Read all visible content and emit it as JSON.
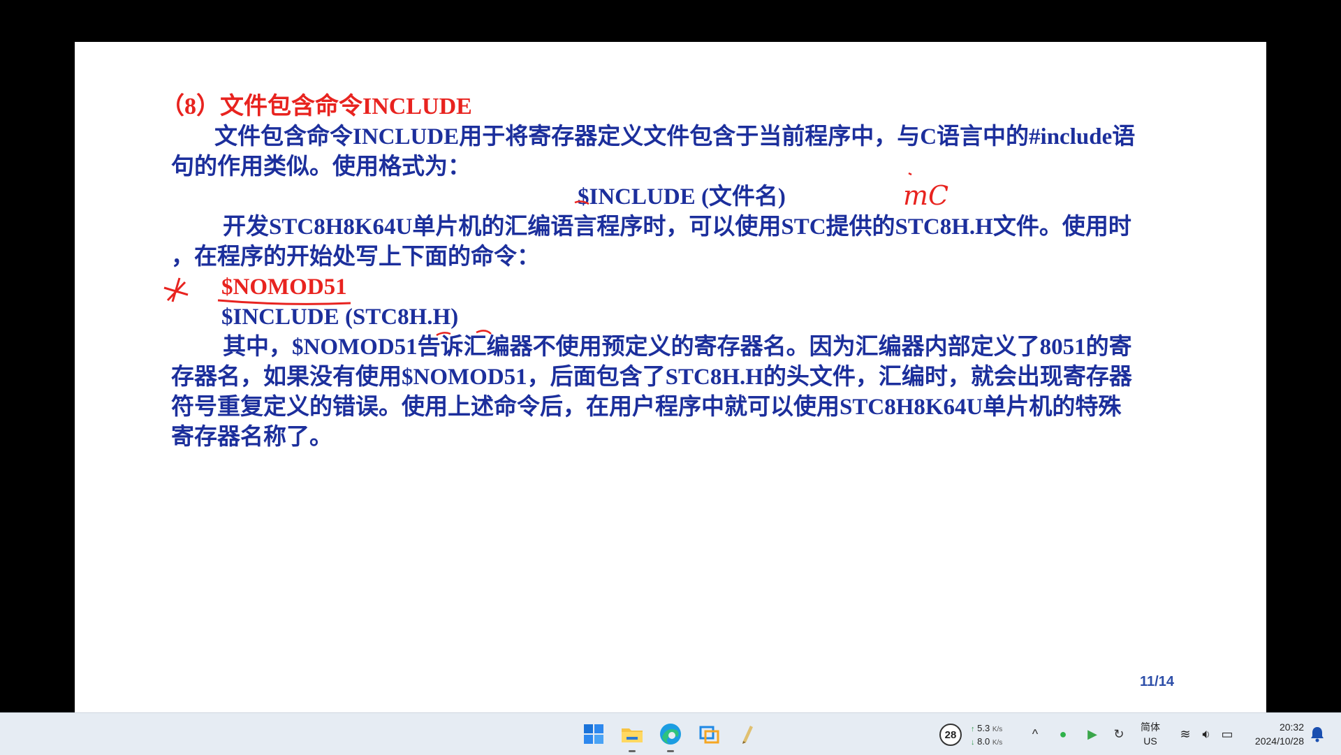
{
  "slide": {
    "heading": "（8）文件包含命令INCLUDE",
    "lines": [
      "文件包含命令INCLUDE用于将寄存器定义文件包含于当前程序中，与C语言中的#include语",
      "句的作用类似。使用格式为：",
      "$INCLUDE  (文件名)",
      "开发STC8H8K64U单片机的汇编语言程序时，可以使用STC提供的STC8H.H文件。使用时",
      "，在程序的开始处写上下面的命令：",
      "$NOMOD51",
      "$INCLUDE (STC8H.H)",
      "其中，$NOMOD51告诉汇编器不使用预定义的寄存器名。因为汇编器内部定义了8051的寄",
      "存器名，如果没有使用$NOMOD51，后面包含了STC8H.H的头文件，汇编时，就会出现寄存器",
      "符号重复定义的错误。使用上述命令后，在用户程序中就可以使用STC8H8K64U单片机的特殊",
      "寄存器名称了。"
    ],
    "annotation_text": "mC",
    "page_number": "11/14"
  },
  "taskbar": {
    "apps": [
      {
        "icon": "windows-start-icon"
      },
      {
        "icon": "file-explorer-icon"
      },
      {
        "icon": "edge-browser-icon"
      },
      {
        "icon": "app-window-icon"
      },
      {
        "icon": "pen-app-icon"
      }
    ],
    "weather_value": "28",
    "upload_speed": "5.3",
    "download_speed": "8.0",
    "speed_unit": "K/s",
    "ime_lang": "简体",
    "ime_layout": "US",
    "time": "20:32",
    "date": "2024/10/28"
  },
  "colors": {
    "heading_red": "#e8231f",
    "body_blue": "#1c2f9c",
    "page_number": "#2d4ea8",
    "taskbar_bg": "#e6ecf3"
  }
}
